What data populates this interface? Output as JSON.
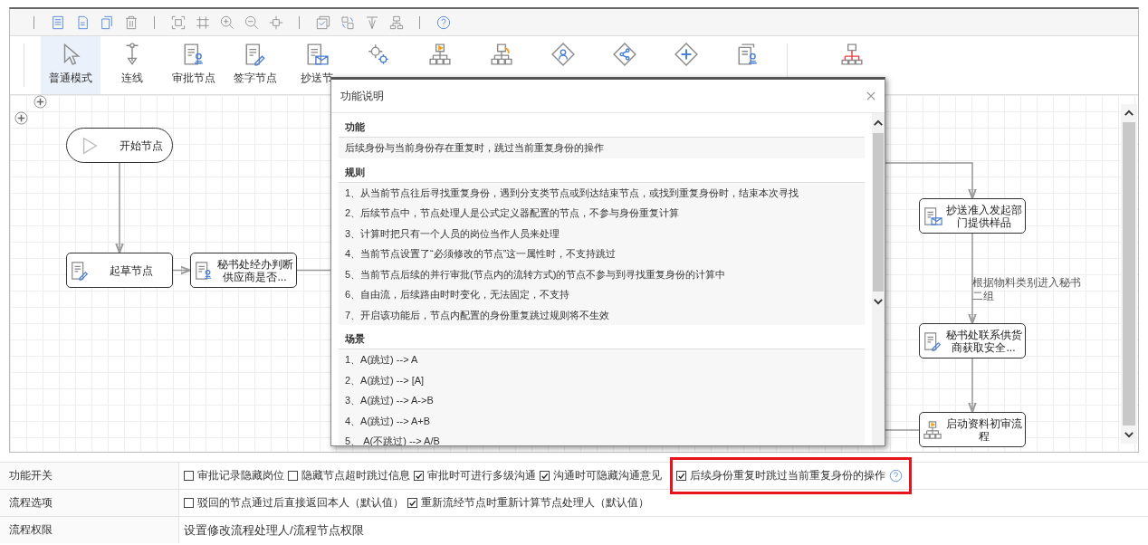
{
  "tools": [
    {
      "label": "普通模式",
      "selected": true
    },
    {
      "label": "连线",
      "selected": false
    },
    {
      "label": "审批节点",
      "selected": false
    },
    {
      "label": "签字节点",
      "selected": false
    },
    {
      "label": "抄送节",
      "selected": false
    }
  ],
  "canvas": {
    "nodes": [
      {
        "kind": "start",
        "label": "开始节点"
      },
      {
        "kind": "draft",
        "label": "起草节点"
      },
      {
        "kind": "approve",
        "label": "秘书处经办判断供应商是否..."
      },
      {
        "kind": "cc",
        "label": "抄送准入发起部门提供样品"
      },
      {
        "kind": "sign",
        "label": "秘书处联系供货商获取安全..."
      },
      {
        "kind": "subprocess",
        "label": "启动资料初审流程"
      }
    ],
    "edge_label": "根据物料类别进入秘书二组"
  },
  "dialog": {
    "title": "功能说明",
    "sections": [
      {
        "heading": "功能",
        "items": [
          "后续身份与当前身份存在重复时，跳过当前重复身份的操作"
        ]
      },
      {
        "heading": "规则",
        "items": [
          "1、从当前节点往后寻找重复身份，遇到分支类节点或到达结束节点，或找到重复身份时，结束本次寻找",
          "2、后续节点中，节点处理人是公式定义器配置的节点，不参与身份重复计算",
          "3、计算时把只有一个人员的岗位当作人员来处理",
          "4、当前节点设置了“必须修改的节点”这一属性时，不支持跳过",
          "5、当前节点后续的并行审批(节点内的流转方式)的节点不参与到寻找重复身份的计算中",
          "6、自由流，后续路由时时变化，无法固定，不支持",
          "7、开启该功能后，节点内配置的身份重复跳过规则将不生效"
        ]
      },
      {
        "heading": "场景",
        "items": [
          "1、A(跳过) --> A",
          "2、A(跳过) --> [A]",
          "3、A(跳过) --> A->B",
          "4、A(跳过) --> A+B",
          "5、 A(不跳过) --> A/B"
        ]
      }
    ]
  },
  "settings": [
    {
      "label": "功能开关",
      "options": [
        {
          "label": "审批记录隐藏岗位",
          "checked": false
        },
        {
          "label": "隐藏节点超时跳过信息",
          "checked": false
        },
        {
          "label": "审批时可进行多级沟通",
          "checked": true
        },
        {
          "label": "沟通时可隐藏沟通意见",
          "checked": true
        }
      ],
      "highlighted_options": [
        {
          "label": "后续身份重复时跳过当前重复身份的操作",
          "checked": true
        }
      ]
    },
    {
      "label": "流程选项",
      "options": [
        {
          "label": "驳回的节点通过后直接返回本人（默认值）",
          "checked": false
        },
        {
          "label": "重新流经节点时重新计算节点处理人（默认值）",
          "checked": true
        }
      ]
    },
    {
      "label": "流程权限",
      "text": "设置修改流程处理人/流程节点权限"
    }
  ]
}
